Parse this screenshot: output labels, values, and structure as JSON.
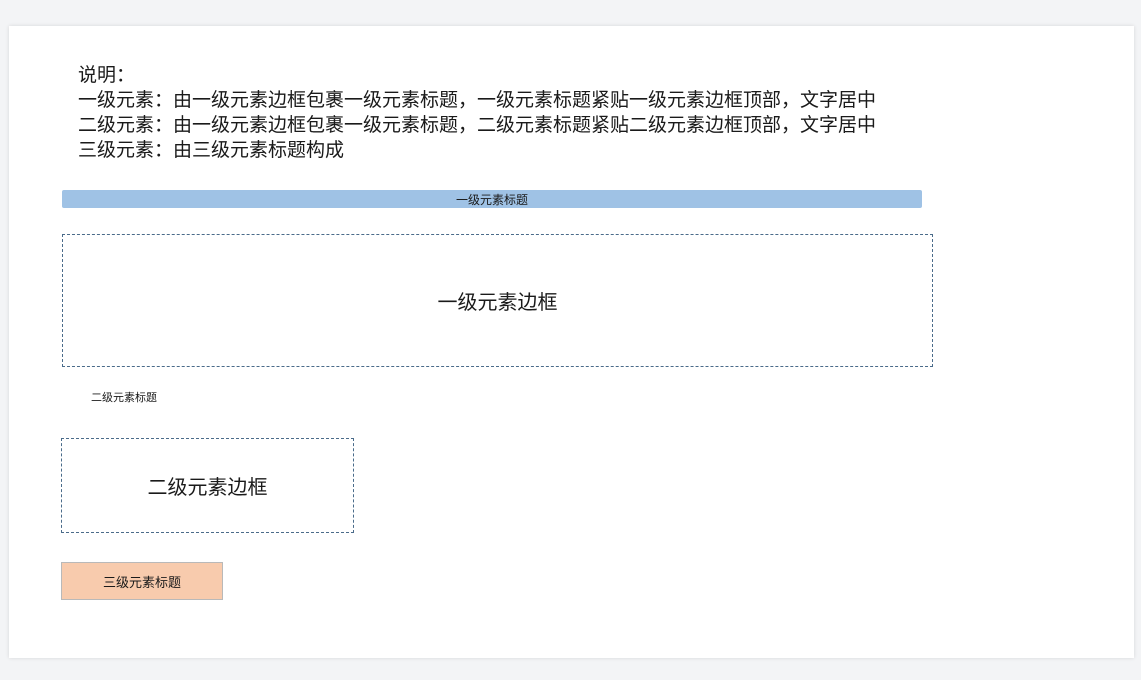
{
  "notes": {
    "heading": "说明：",
    "line1": "一级元素：由一级元素边框包裹一级元素标题，一级元素标题紧贴一级元素边框顶部，文字居中",
    "line2": "二级元素：由一级元素边框包裹一级元素标题，二级元素标题紧贴二级元素边框顶部，文字居中",
    "line3": "三级元素：由三级元素标题构成"
  },
  "level1": {
    "title": "一级元素标题",
    "border_label": "一级元素边框",
    "title_color": "#9fc2e5",
    "border_color": "#4a6b8a"
  },
  "level2": {
    "title": "二级元素标题",
    "border_label": "二级元素边框",
    "border_color": "#4a6b8a"
  },
  "level3": {
    "title": "三级元素标题",
    "fill_color": "#f8cbad"
  }
}
